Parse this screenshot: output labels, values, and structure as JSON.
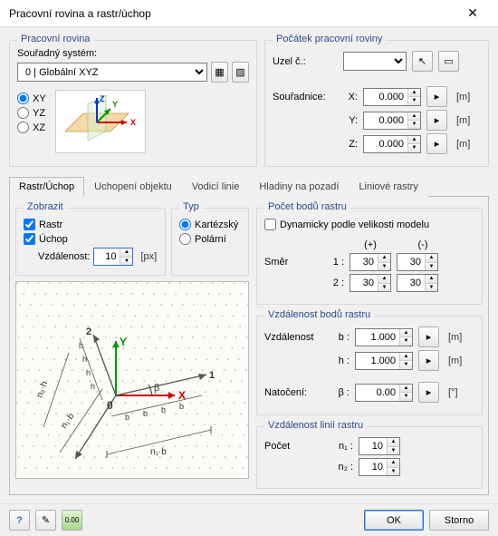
{
  "window": {
    "title": "Pracovní rovina a rastr/úchop"
  },
  "workplane": {
    "group_title": "Pracovní rovina",
    "coord_system_label": "Souřadný systém:",
    "coord_system_value": "0 | Globální XYZ",
    "plane_xy": "XY",
    "plane_yz": "YZ",
    "plane_xz": "XZ",
    "plane_selected": "XY"
  },
  "origin": {
    "group_title": "Počátek pracovní roviny",
    "node_label": "Uzel č.:",
    "node_value": "",
    "coords_label": "Souřadnice:",
    "x_label": "X:",
    "y_label": "Y:",
    "z_label": "Z:",
    "x_value": "0.000",
    "y_value": "0.000",
    "z_value": "0.000",
    "unit": "[m]"
  },
  "tabs": {
    "t1": "Rastr/Úchop",
    "t2": "Uchopení objektu",
    "t3": "Vodicí linie",
    "t4": "Hladiny na pozadí",
    "t5": "Liniové rastry",
    "active": "t1"
  },
  "display": {
    "group_title": "Zobrazit",
    "rastr_label": "Rastr",
    "uchop_label": "Úchop",
    "vzdalenost_label": "Vzdálenost:",
    "vzdalenost_value": "10",
    "vzdalenost_unit": "[px]",
    "rastr_checked": true,
    "uchop_checked": true
  },
  "type": {
    "group_title": "Typ",
    "kart_label": "Kartézský",
    "polar_label": "Polární",
    "selected": "kart"
  },
  "points": {
    "group_title": "Počet bodů rastru",
    "dyn_label": "Dynamicky podle velikosti modelu",
    "dyn_checked": false,
    "plus_label": "(+)",
    "minus_label": "(-)",
    "dir_label": "Směr",
    "row1_label": "1 :",
    "row2_label": "2 :",
    "v1p": "30",
    "v1m": "30",
    "v2p": "30",
    "v2m": "30"
  },
  "dist": {
    "group_title": "Vzdálenost bodů rastru",
    "dist_label": "Vzdálenost",
    "b_label": "b :",
    "h_label": "h :",
    "b_value": "1.000",
    "h_value": "1.000",
    "unit": "[m]",
    "rot_label": "Natočení:",
    "beta_label": "β :",
    "beta_value": "0.00",
    "beta_unit": "[°]"
  },
  "lines": {
    "group_title": "Vzdálenost linií rastru",
    "count_label": "Počet",
    "n1_label": "n₁ :",
    "n2_label": "n₂ :",
    "n1_value": "10",
    "n2_value": "10"
  },
  "footer": {
    "ok": "OK",
    "cancel": "Storno"
  },
  "icons": {
    "pick": "↖",
    "new": "📄",
    "apply": "✔",
    "tool": "🛠",
    "help": "?",
    "edit": "✎",
    "opts": "⚙"
  }
}
